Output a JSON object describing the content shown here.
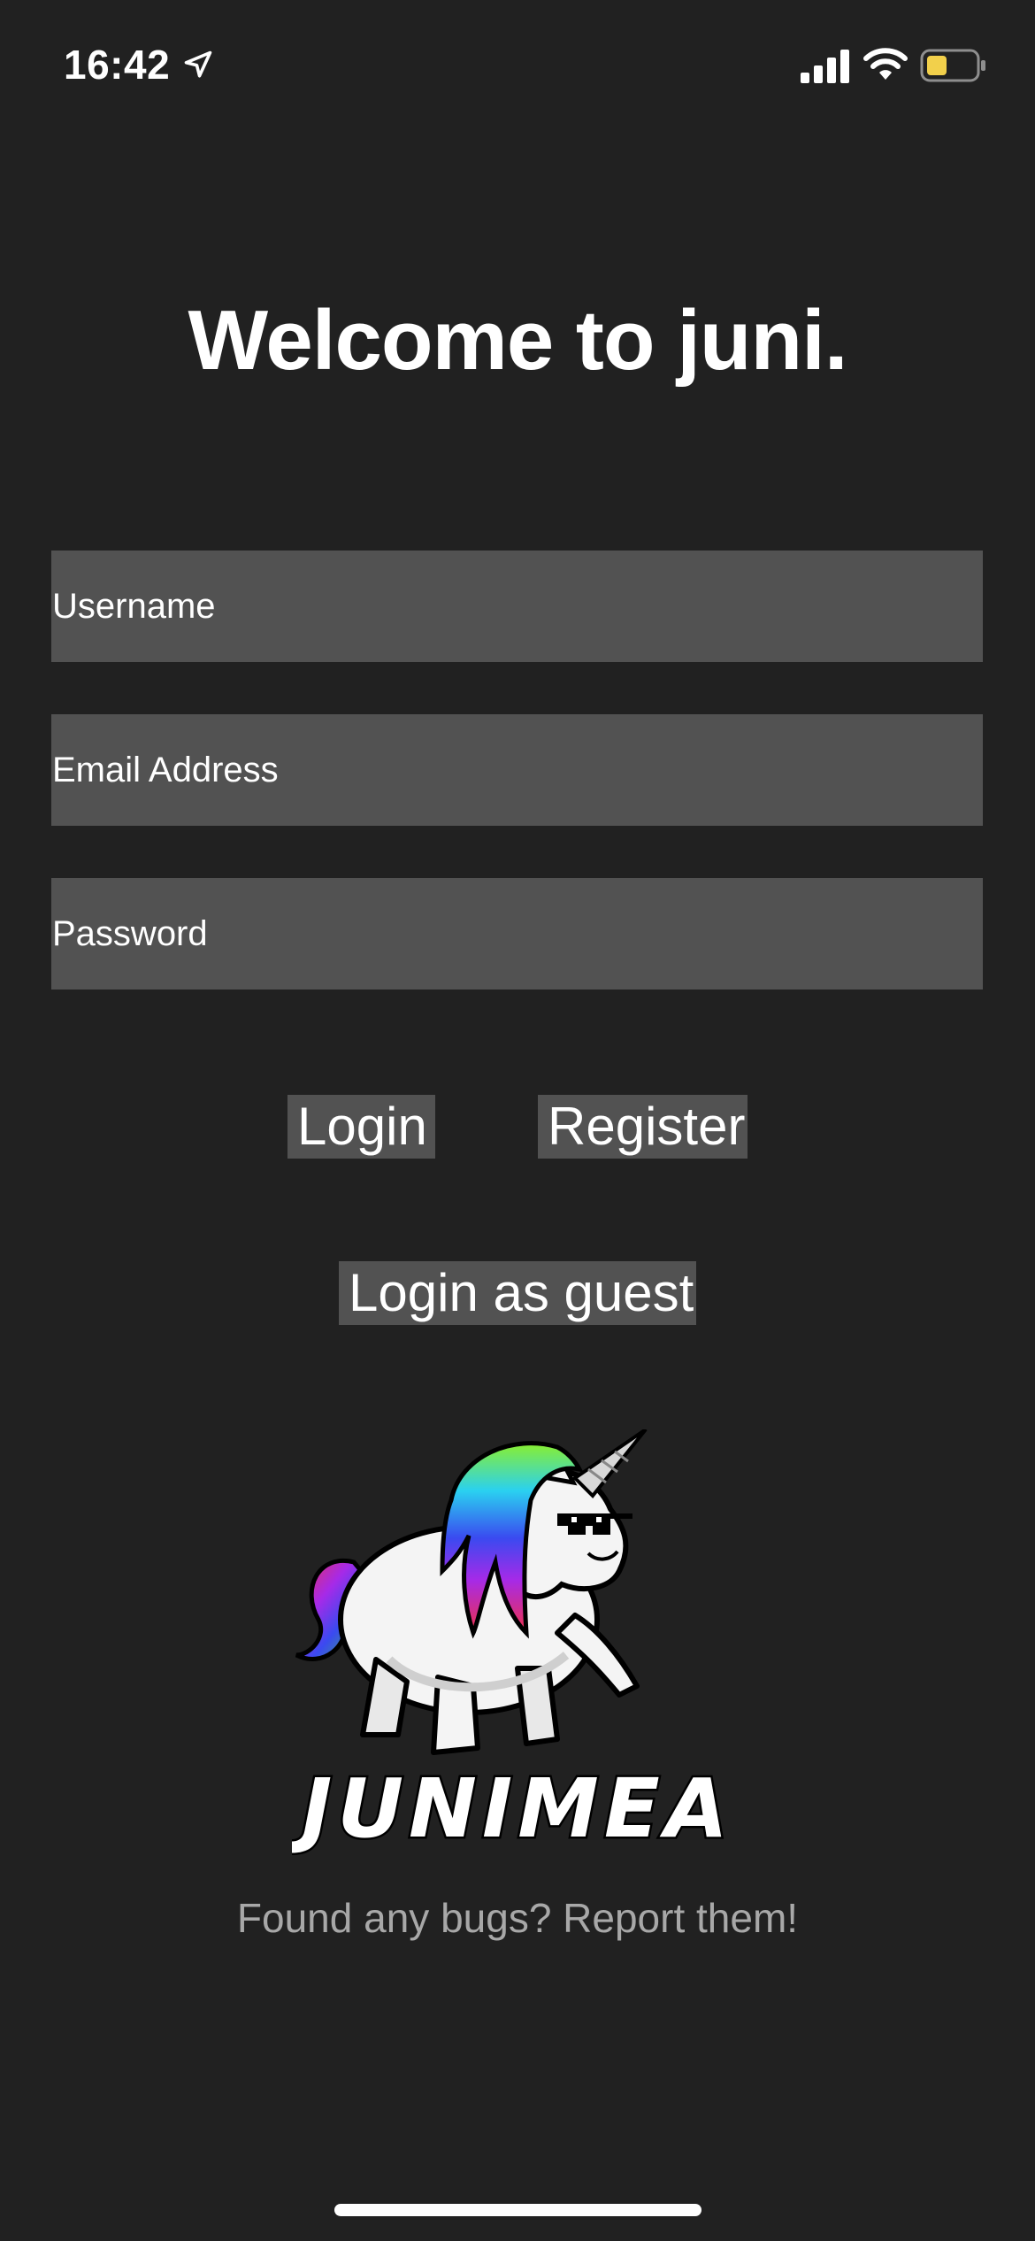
{
  "status_bar": {
    "time": "16:42",
    "battery_color": "#f2d04b"
  },
  "title": "Welcome to juni.",
  "form": {
    "username_placeholder": "Username",
    "email_placeholder": "Email Address",
    "password_placeholder": "Password"
  },
  "buttons": {
    "login": "Login",
    "register": "Register",
    "guest": "Login as guest"
  },
  "logo": {
    "wordmark": "JUNIMEA"
  },
  "footer": {
    "bug_report": "Found any bugs? Report them!"
  },
  "colors": {
    "background": "#212121",
    "field": "#525252",
    "muted_text": "#a8a8a8"
  }
}
